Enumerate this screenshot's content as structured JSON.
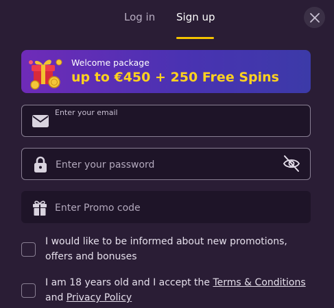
{
  "tabs": {
    "login": "Log in",
    "signup": "Sign up",
    "active": "signup"
  },
  "close": {
    "icon": "close-icon"
  },
  "banner": {
    "icon": "gift-coins-icon",
    "subtitle": "Welcome package",
    "headline": "up to €450 + 250 Free Spins"
  },
  "form": {
    "email": {
      "icon": "envelope-icon",
      "label": "Enter your email",
      "value": ""
    },
    "password": {
      "icon": "lock-icon",
      "placeholder": "Enter your password",
      "value": "",
      "toggle_icon": "eye-off-icon"
    },
    "promo": {
      "icon": "gift-icon",
      "placeholder": "Enter Promo code",
      "value": ""
    }
  },
  "consents": {
    "promotions": {
      "text": "I would like to be informed about new promotions, offers and bonuses",
      "checked": false
    },
    "age": {
      "text_before": "I am 18 years old and I accept the ",
      "terms_link": "Terms & Conditions",
      "text_middle": " and ",
      "privacy_link": "Privacy Policy",
      "checked": false
    }
  },
  "colors": {
    "background": "#2a1d35",
    "field_background": "#1e1428",
    "accent": "#f5c400",
    "banner_headline": "#ffd21f"
  }
}
